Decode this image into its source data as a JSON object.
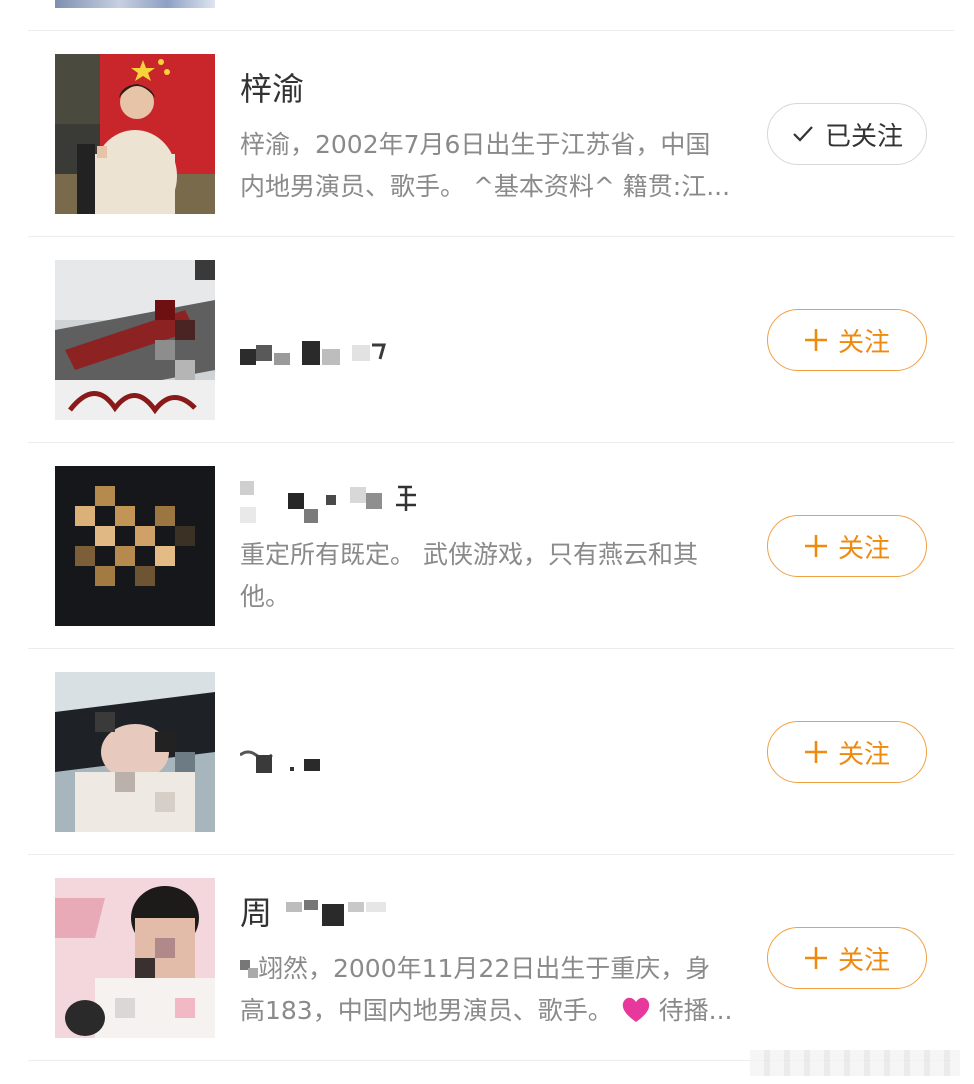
{
  "items": [
    {
      "title": "梓渝",
      "desc_line1": "梓渝，2002年7月6日出生于江苏省，中国",
      "desc_line2": "内地男演员、歌手。 ^基本资料^ 籍贯:江...",
      "button": {
        "label": "已关注",
        "state": "followed",
        "icon": "check-icon"
      }
    },
    {
      "title": "",
      "button": {
        "label": "关注",
        "state": "unfollowed",
        "icon": "plus-icon"
      }
    },
    {
      "title": "",
      "desc_line1": "重定所有既定。 武侠游戏，只有燕云和其",
      "desc_line2": "他。",
      "button": {
        "label": "关注",
        "state": "unfollowed",
        "icon": "plus-icon"
      }
    },
    {
      "title": "",
      "button": {
        "label": "关注",
        "state": "unfollowed",
        "icon": "plus-icon"
      }
    },
    {
      "title": "周",
      "desc_line1": "翊然，2000年11月22日出生于重庆，身",
      "desc_line2_pre": "高183，中国内地男演员、歌手。",
      "desc_line2_post": "待播...",
      "button": {
        "label": "关注",
        "state": "unfollowed",
        "icon": "plus-icon"
      }
    }
  ],
  "colors": {
    "accent": "#ee8a10",
    "accent_border": "#f0a044",
    "heart": "#e6399b",
    "text_primary": "#333333",
    "text_secondary": "#8a8a8a",
    "divider": "#ececec"
  }
}
